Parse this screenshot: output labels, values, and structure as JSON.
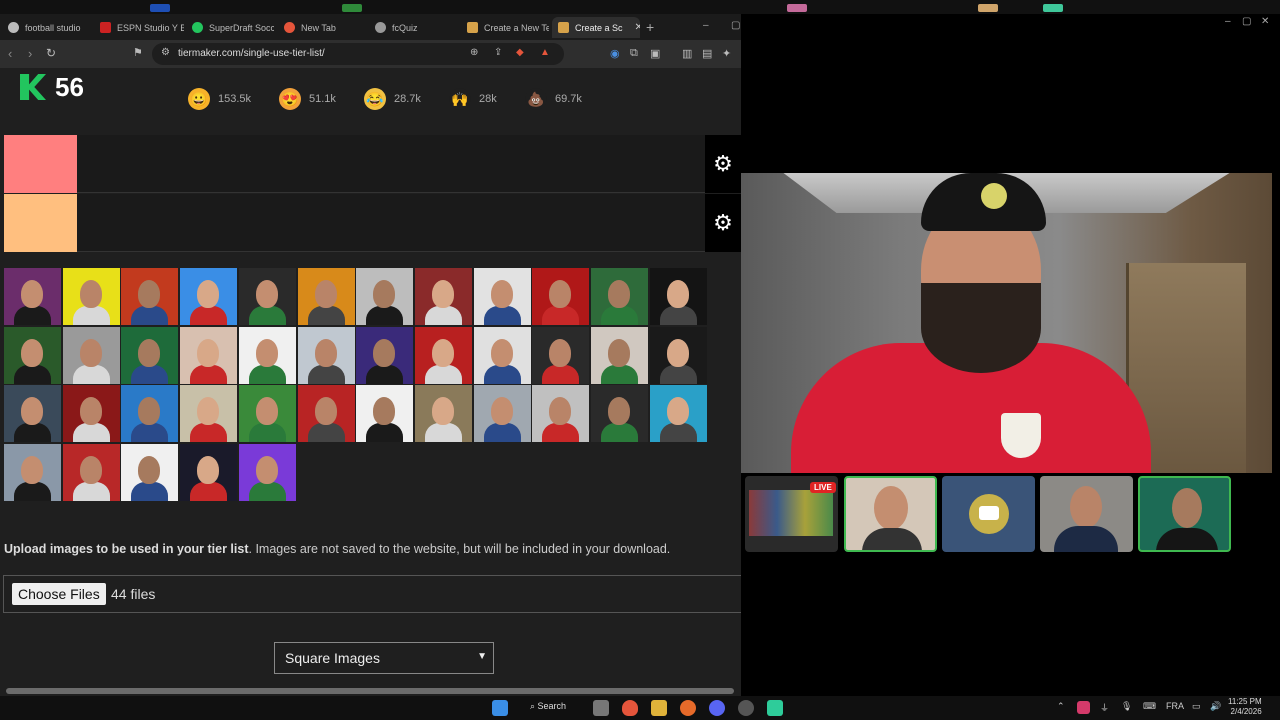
{
  "browser": {
    "tabs": [
      {
        "label": "football studio",
        "color": "#bbbbbb"
      },
      {
        "label": "ESPN Studio Y B",
        "color": "#cc2222"
      },
      {
        "label": "SuperDraft Socc",
        "color": "#23c55e"
      },
      {
        "label": "New Tab",
        "color": "#e5553b"
      },
      {
        "label": "fcQuiz",
        "color": "#999999"
      },
      {
        "label": "Create a New Te",
        "color": "#d6a24a"
      },
      {
        "label": "Create a Sc",
        "color": "#d6a24a"
      }
    ],
    "address": "tiermaker.com/single-use-tier-list/"
  },
  "page": {
    "logo_number": "56",
    "reactions": [
      {
        "emoji": "😀",
        "count": "153.5k",
        "bg": "#f6b22a"
      },
      {
        "emoji": "😍",
        "count": "51.1k",
        "bg": "#f2a13a"
      },
      {
        "emoji": "😂",
        "count": "28.7k",
        "bg": "#f0c142"
      },
      {
        "emoji": "🙌",
        "count": "28k",
        "bg": "#1f1f1f"
      },
      {
        "emoji": "💩",
        "count": "69.7k",
        "bg": "#1f1f1f"
      }
    ],
    "tiers": [
      {
        "color": "#ff7f7f"
      },
      {
        "color": "#ffbf7f"
      }
    ],
    "upload_bold": "Upload images to be used in your tier list",
    "upload_rest": ". Images are not saved to the website, but will be included in your download.",
    "choose_files": "Choose Files",
    "file_count": "44 files",
    "shape_select": "Square Images"
  },
  "video": {
    "live_label": "LIVE"
  },
  "taskbar": {
    "search_label": "Search",
    "lang": "FRA",
    "time": "11:25 PM",
    "date": "2/4/2026"
  }
}
